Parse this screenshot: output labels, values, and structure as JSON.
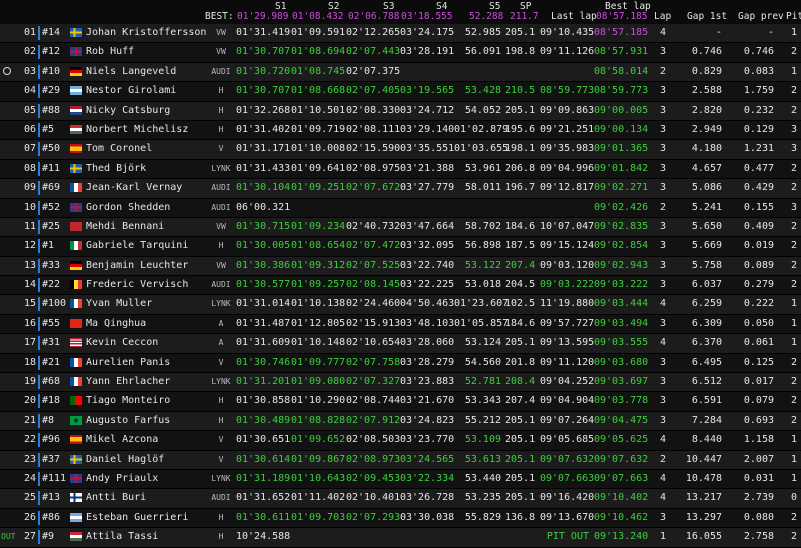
{
  "header": {
    "best_label": "BEST:",
    "cols": {
      "s1": "S1",
      "s2": "S2",
      "s3": "S3",
      "s4": "S4",
      "s5": "S5",
      "sp": "SP",
      "last": "Last lap",
      "best_top": "Best lap",
      "lap": "Lap",
      "gap1": "Gap 1st",
      "gapp": "Gap prev",
      "pit": "Pit"
    },
    "best": {
      "s1": "01'29.989",
      "s2": "01'08.432",
      "s3": "02'06.788",
      "s4": "03'18.555",
      "s5": "52.288",
      "sp": "211.7",
      "best": "08'57.185"
    }
  },
  "rows": [
    {
      "pos": "01",
      "num": "#14",
      "flag": "se",
      "name": "Johan Kristoffersson",
      "logo": "VW",
      "s1": [
        "01'31.419",
        "w"
      ],
      "s2": [
        "01'09.591",
        "w"
      ],
      "s3": [
        "02'12.265",
        "w"
      ],
      "s4": [
        "03'24.175",
        "w"
      ],
      "s5": [
        "52.985",
        "w"
      ],
      "sp": [
        "205.1",
        "w"
      ],
      "last": [
        "09'10.435",
        "w"
      ],
      "best": [
        "08'57.185",
        "p"
      ],
      "lap": "4",
      "gap1": "-",
      "gapp": "-",
      "pit": "1"
    },
    {
      "pos": "02",
      "num": "#12",
      "flag": "gb",
      "name": "Rob Huff",
      "logo": "VW",
      "s1": [
        "01'30.707",
        "g"
      ],
      "s2": [
        "01'08.694",
        "g"
      ],
      "s3": [
        "02'07.443",
        "g"
      ],
      "s4": [
        "03'28.191",
        "w"
      ],
      "s5": [
        "56.091",
        "w"
      ],
      "sp": [
        "198.8",
        "w"
      ],
      "last": [
        "09'11.126",
        "w"
      ],
      "best": [
        "08'57.931",
        "g"
      ],
      "lap": "3",
      "gap1": "0.746",
      "gapp": "0.746",
      "pit": "2"
    },
    {
      "pos": "03",
      "num": "#10",
      "flag": "de",
      "name": "Niels Langeveld",
      "logo": "AUDI",
      "s1": [
        "01'30.720",
        "g"
      ],
      "s2": [
        "01'08.745",
        "g"
      ],
      "s3": [
        "02'07.375",
        "w"
      ],
      "s4": [
        "",
        "w"
      ],
      "s5": [
        "",
        "w"
      ],
      "sp": [
        "",
        "w"
      ],
      "last": [
        "",
        "w"
      ],
      "best": [
        "08'58.014",
        "g"
      ],
      "lap": "2",
      "gap1": "0.829",
      "gapp": "0.083",
      "pit": "1"
    },
    {
      "pos": "04",
      "num": "#29",
      "flag": "ar",
      "name": "Nestor Girolami",
      "logo": "H",
      "s1": [
        "01'30.707",
        "g"
      ],
      "s2": [
        "01'08.668",
        "g"
      ],
      "s3": [
        "02'07.405",
        "g"
      ],
      "s4": [
        "03'19.565",
        "g"
      ],
      "s5": [
        "53.428",
        "g"
      ],
      "sp": [
        "210.5",
        "g"
      ],
      "last": [
        "08'59.773",
        "g"
      ],
      "best": [
        "08'59.773",
        "g"
      ],
      "lap": "3",
      "gap1": "2.588",
      "gapp": "1.759",
      "pit": "2"
    },
    {
      "pos": "05",
      "num": "#88",
      "flag": "nl",
      "name": "Nicky Catsburg",
      "logo": "H",
      "s1": [
        "01'32.268",
        "w"
      ],
      "s2": [
        "01'10.501",
        "w"
      ],
      "s3": [
        "02'08.330",
        "w"
      ],
      "s4": [
        "03'24.712",
        "w"
      ],
      "s5": [
        "54.052",
        "w"
      ],
      "sp": [
        "205.1",
        "w"
      ],
      "last": [
        "09'09.863",
        "w"
      ],
      "best": [
        "09'00.005",
        "g"
      ],
      "lap": "3",
      "gap1": "2.820",
      "gapp": "0.232",
      "pit": "2"
    },
    {
      "pos": "06",
      "num": "#5",
      "flag": "hu",
      "name": "Norbert Michelisz",
      "logo": "H",
      "s1": [
        "01'31.402",
        "w"
      ],
      "s2": [
        "01'09.719",
        "w"
      ],
      "s3": [
        "02'08.111",
        "w"
      ],
      "s4": [
        "03'29.140",
        "w"
      ],
      "s5": [
        "01'02.879",
        "w"
      ],
      "sp": [
        "195.6",
        "w"
      ],
      "last": [
        "09'21.251",
        "w"
      ],
      "best": [
        "09'00.134",
        "g"
      ],
      "lap": "3",
      "gap1": "2.949",
      "gapp": "0.129",
      "pit": "3"
    },
    {
      "pos": "07",
      "num": "#50",
      "flag": "es",
      "name": "Tom Coronel",
      "logo": "V",
      "s1": [
        "01'31.171",
        "w"
      ],
      "s2": [
        "01'10.008",
        "w"
      ],
      "s3": [
        "02'15.590",
        "w"
      ],
      "s4": [
        "03'35.551",
        "w"
      ],
      "s5": [
        "01'03.655",
        "w"
      ],
      "sp": [
        "198.1",
        "w"
      ],
      "last": [
        "09'35.983",
        "w"
      ],
      "best": [
        "09'01.365",
        "g"
      ],
      "lap": "3",
      "gap1": "4.180",
      "gapp": "1.231",
      "pit": "3"
    },
    {
      "pos": "08",
      "num": "#11",
      "flag": "se",
      "name": "Thed Björk",
      "logo": "LYNK",
      "s1": [
        "01'31.433",
        "w"
      ],
      "s2": [
        "01'09.641",
        "w"
      ],
      "s3": [
        "02'08.975",
        "w"
      ],
      "s4": [
        "03'21.388",
        "w"
      ],
      "s5": [
        "53.961",
        "w"
      ],
      "sp": [
        "206.8",
        "w"
      ],
      "last": [
        "09'04.996",
        "w"
      ],
      "best": [
        "09'01.842",
        "g"
      ],
      "lap": "3",
      "gap1": "4.657",
      "gapp": "0.477",
      "pit": "2"
    },
    {
      "pos": "09",
      "num": "#69",
      "flag": "fr",
      "name": "Jean-Karl Vernay",
      "logo": "AUDI",
      "s1": [
        "01'30.104",
        "g"
      ],
      "s2": [
        "01'09.251",
        "g"
      ],
      "s3": [
        "02'07.672",
        "g"
      ],
      "s4": [
        "03'27.779",
        "w"
      ],
      "s5": [
        "58.011",
        "w"
      ],
      "sp": [
        "196.7",
        "w"
      ],
      "last": [
        "09'12.817",
        "w"
      ],
      "best": [
        "09'02.271",
        "g"
      ],
      "lap": "3",
      "gap1": "5.086",
      "gapp": "0.429",
      "pit": "2"
    },
    {
      "pos": "10",
      "num": "#52",
      "flag": "gb",
      "name": "Gordon Shedden",
      "logo": "AUDI",
      "s1": [
        "06'00.321",
        "w"
      ],
      "s2": [
        "",
        "w"
      ],
      "s3": [
        "",
        "w"
      ],
      "s4": [
        "",
        "w"
      ],
      "s5": [
        "",
        "w"
      ],
      "sp": [
        "",
        "w"
      ],
      "last": [
        "",
        "w"
      ],
      "best": [
        "09'02.426",
        "g"
      ],
      "lap": "2",
      "gap1": "5.241",
      "gapp": "0.155",
      "pit": "3"
    },
    {
      "pos": "11",
      "num": "#25",
      "flag": "ma",
      "name": "Mehdi Bennani",
      "logo": "VW",
      "s1": [
        "01'30.715",
        "g"
      ],
      "s2": [
        "01'09.234",
        "g"
      ],
      "s3": [
        "02'40.732",
        "w"
      ],
      "s4": [
        "03'47.664",
        "w"
      ],
      "s5": [
        "58.702",
        "w"
      ],
      "sp": [
        "184.6",
        "w"
      ],
      "last": [
        "10'07.047",
        "w"
      ],
      "best": [
        "09'02.835",
        "g"
      ],
      "lap": "3",
      "gap1": "5.650",
      "gapp": "0.409",
      "pit": "2"
    },
    {
      "pos": "12",
      "num": "#1",
      "flag": "it",
      "name": "Gabriele Tarquini",
      "logo": "H",
      "s1": [
        "01'30.005",
        "g"
      ],
      "s2": [
        "01'08.654",
        "g"
      ],
      "s3": [
        "02'07.472",
        "g"
      ],
      "s4": [
        "03'32.095",
        "w"
      ],
      "s5": [
        "56.898",
        "w"
      ],
      "sp": [
        "187.5",
        "w"
      ],
      "last": [
        "09'15.124",
        "w"
      ],
      "best": [
        "09'02.854",
        "g"
      ],
      "lap": "3",
      "gap1": "5.669",
      "gapp": "0.019",
      "pit": "2"
    },
    {
      "pos": "13",
      "num": "#33",
      "flag": "de",
      "name": "Benjamin Leuchter",
      "logo": "VW",
      "s1": [
        "01'30.386",
        "g"
      ],
      "s2": [
        "01'09.312",
        "g"
      ],
      "s3": [
        "02'07.525",
        "g"
      ],
      "s4": [
        "03'22.740",
        "w"
      ],
      "s5": [
        "53.122",
        "g"
      ],
      "sp": [
        "207.4",
        "g"
      ],
      "last": [
        "09'03.120",
        "w"
      ],
      "best": [
        "09'02.943",
        "g"
      ],
      "lap": "3",
      "gap1": "5.758",
      "gapp": "0.089",
      "pit": "2"
    },
    {
      "pos": "14",
      "num": "#22",
      "flag": "be",
      "name": "Frederic Vervisch",
      "logo": "AUDI",
      "s1": [
        "01'30.577",
        "g"
      ],
      "s2": [
        "01'09.257",
        "g"
      ],
      "s3": [
        "02'08.145",
        "g"
      ],
      "s4": [
        "03'22.225",
        "w"
      ],
      "s5": [
        "53.018",
        "w"
      ],
      "sp": [
        "204.5",
        "w"
      ],
      "last": [
        "09'03.222",
        "g"
      ],
      "best": [
        "09'03.222",
        "g"
      ],
      "lap": "3",
      "gap1": "6.037",
      "gapp": "0.279",
      "pit": "2"
    },
    {
      "pos": "15",
      "num": "#100",
      "flag": "fr",
      "name": "Yvan Muller",
      "logo": "LYNK",
      "s1": [
        "01'31.014",
        "w"
      ],
      "s2": [
        "01'10.138",
        "w"
      ],
      "s3": [
        "02'24.460",
        "w"
      ],
      "s4": [
        "04'50.463",
        "w"
      ],
      "s5": [
        "01'23.607",
        "w"
      ],
      "sp": [
        "102.5",
        "w"
      ],
      "last": [
        "11'19.880",
        "w"
      ],
      "best": [
        "09'03.444",
        "g"
      ],
      "lap": "4",
      "gap1": "6.259",
      "gapp": "0.222",
      "pit": "1"
    },
    {
      "pos": "16",
      "num": "#55",
      "flag": "cn",
      "name": "Ma Qinghua",
      "logo": "A",
      "s1": [
        "01'31.487",
        "w"
      ],
      "s2": [
        "01'12.805",
        "w"
      ],
      "s3": [
        "02'15.913",
        "w"
      ],
      "s4": [
        "03'48.103",
        "w"
      ],
      "s5": [
        "01'05.857",
        "w"
      ],
      "sp": [
        "184.6",
        "w"
      ],
      "last": [
        "09'57.727",
        "w"
      ],
      "best": [
        "09'03.494",
        "g"
      ],
      "lap": "3",
      "gap1": "6.309",
      "gapp": "0.050",
      "pit": "1"
    },
    {
      "pos": "17",
      "num": "#31",
      "flag": "us",
      "name": "Kevin Ceccon",
      "logo": "A",
      "s1": [
        "01'31.609",
        "w"
      ],
      "s2": [
        "01'10.148",
        "w"
      ],
      "s3": [
        "02'10.654",
        "w"
      ],
      "s4": [
        "03'28.060",
        "w"
      ],
      "s5": [
        "53.124",
        "w"
      ],
      "sp": [
        "205.1",
        "w"
      ],
      "last": [
        "09'13.595",
        "w"
      ],
      "best": [
        "09'03.555",
        "g"
      ],
      "lap": "4",
      "gap1": "6.370",
      "gapp": "0.061",
      "pit": "1"
    },
    {
      "pos": "18",
      "num": "#21",
      "flag": "fr",
      "name": "Aurelien Panis",
      "logo": "V",
      "s1": [
        "01'30.746",
        "g"
      ],
      "s2": [
        "01'09.777",
        "g"
      ],
      "s3": [
        "02'07.758",
        "g"
      ],
      "s4": [
        "03'28.279",
        "w"
      ],
      "s5": [
        "54.560",
        "w"
      ],
      "sp": [
        "201.8",
        "w"
      ],
      "last": [
        "09'11.120",
        "w"
      ],
      "best": [
        "09'03.680",
        "g"
      ],
      "lap": "3",
      "gap1": "6.495",
      "gapp": "0.125",
      "pit": "2"
    },
    {
      "pos": "19",
      "num": "#68",
      "flag": "fr",
      "name": "Yann Ehrlacher",
      "logo": "LYNK",
      "s1": [
        "01'31.201",
        "g"
      ],
      "s2": [
        "01'09.080",
        "g"
      ],
      "s3": [
        "02'07.327",
        "g"
      ],
      "s4": [
        "03'23.883",
        "w"
      ],
      "s5": [
        "52.781",
        "g"
      ],
      "sp": [
        "208.4",
        "g"
      ],
      "last": [
        "09'04.252",
        "w"
      ],
      "best": [
        "09'03.697",
        "g"
      ],
      "lap": "3",
      "gap1": "6.512",
      "gapp": "0.017",
      "pit": "2"
    },
    {
      "pos": "20",
      "num": "#18",
      "flag": "pt",
      "name": "Tiago Monteiro",
      "logo": "H",
      "s1": [
        "01'30.858",
        "w"
      ],
      "s2": [
        "01'10.290",
        "w"
      ],
      "s3": [
        "02'08.744",
        "w"
      ],
      "s4": [
        "03'21.670",
        "w"
      ],
      "s5": [
        "53.343",
        "w"
      ],
      "sp": [
        "207.4",
        "w"
      ],
      "last": [
        "09'04.904",
        "w"
      ],
      "best": [
        "09'03.778",
        "g"
      ],
      "lap": "3",
      "gap1": "6.591",
      "gapp": "0.079",
      "pit": "2"
    },
    {
      "pos": "21",
      "num": "#8",
      "flag": "br",
      "name": "Augusto Farfus",
      "logo": "H",
      "s1": [
        "01'30.489",
        "g"
      ],
      "s2": [
        "01'08.828",
        "g"
      ],
      "s3": [
        "02'07.912",
        "g"
      ],
      "s4": [
        "03'24.823",
        "w"
      ],
      "s5": [
        "55.212",
        "w"
      ],
      "sp": [
        "205.1",
        "w"
      ],
      "last": [
        "09'07.264",
        "w"
      ],
      "best": [
        "09'04.475",
        "g"
      ],
      "lap": "3",
      "gap1": "7.284",
      "gapp": "0.693",
      "pit": "2"
    },
    {
      "pos": "22",
      "num": "#96",
      "flag": "es",
      "name": "Mikel Azcona",
      "logo": "V",
      "s1": [
        "01'30.651",
        "w"
      ],
      "s2": [
        "01'09.652",
        "g"
      ],
      "s3": [
        "02'08.503",
        "w"
      ],
      "s4": [
        "03'23.770",
        "w"
      ],
      "s5": [
        "53.109",
        "g"
      ],
      "sp": [
        "205.1",
        "w"
      ],
      "last": [
        "09'05.685",
        "w"
      ],
      "best": [
        "09'05.625",
        "g"
      ],
      "lap": "4",
      "gap1": "8.440",
      "gapp": "1.158",
      "pit": "1"
    },
    {
      "pos": "23",
      "num": "#37",
      "flag": "se",
      "name": "Daniel Haglöf",
      "logo": "V",
      "s1": [
        "01'30.614",
        "g"
      ],
      "s2": [
        "01'09.867",
        "g"
      ],
      "s3": [
        "02'08.973",
        "g"
      ],
      "s4": [
        "03'24.565",
        "g"
      ],
      "s5": [
        "53.613",
        "g"
      ],
      "sp": [
        "205.1",
        "g"
      ],
      "last": [
        "09'07.632",
        "g"
      ],
      "best": [
        "09'07.632",
        "g"
      ],
      "lap": "2",
      "gap1": "10.447",
      "gapp": "2.007",
      "pit": "1"
    },
    {
      "pos": "24",
      "num": "#111",
      "flag": "gb",
      "name": "Andy Priaulx",
      "logo": "LYNK",
      "s1": [
        "01'31.189",
        "g"
      ],
      "s2": [
        "01'10.643",
        "g"
      ],
      "s3": [
        "02'09.453",
        "g"
      ],
      "s4": [
        "03'22.334",
        "g"
      ],
      "s5": [
        "53.440",
        "w"
      ],
      "sp": [
        "205.1",
        "w"
      ],
      "last": [
        "09'07.663",
        "g"
      ],
      "best": [
        "09'07.663",
        "g"
      ],
      "lap": "4",
      "gap1": "10.478",
      "gapp": "0.031",
      "pit": "1"
    },
    {
      "pos": "25",
      "num": "#13",
      "flag": "fi",
      "name": "Antti Buri",
      "logo": "AUDI",
      "s1": [
        "01'31.652",
        "w"
      ],
      "s2": [
        "01'11.402",
        "w"
      ],
      "s3": [
        "02'10.401",
        "w"
      ],
      "s4": [
        "03'26.728",
        "w"
      ],
      "s5": [
        "53.235",
        "w"
      ],
      "sp": [
        "205.1",
        "w"
      ],
      "last": [
        "09'16.420",
        "w"
      ],
      "best": [
        "09'10.402",
        "g"
      ],
      "lap": "4",
      "gap1": "13.217",
      "gapp": "2.739",
      "pit": "0"
    },
    {
      "pos": "26",
      "num": "#86",
      "flag": "ar",
      "name": "Esteban Guerrieri",
      "logo": "H",
      "s1": [
        "01'30.611",
        "g"
      ],
      "s2": [
        "01'09.703",
        "g"
      ],
      "s3": [
        "02'07.293",
        "g"
      ],
      "s4": [
        "03'30.038",
        "w"
      ],
      "s5": [
        "55.829",
        "w"
      ],
      "sp": [
        "136.8",
        "w"
      ],
      "last": [
        "09'13.670",
        "w"
      ],
      "best": [
        "09'10.462",
        "g"
      ],
      "lap": "3",
      "gap1": "13.297",
      "gapp": "0.080",
      "pit": "2"
    },
    {
      "pos": "27",
      "num": "#9",
      "flag": "hu",
      "name": "Attila Tassi",
      "logo": "H",
      "s1": [
        "10'24.588",
        "w"
      ],
      "s2": [
        "",
        "w"
      ],
      "s3": [
        "",
        "w"
      ],
      "s4": [
        "",
        "w"
      ],
      "s5": [
        "",
        "w"
      ],
      "sp": [
        "",
        "w"
      ],
      "last": [
        "PIT OUT",
        "g"
      ],
      "best": [
        "09'13.240",
        "g"
      ],
      "lap": "1",
      "gap1": "16.055",
      "gapp": "2.758",
      "pit": "2"
    }
  ],
  "side": {
    "out_label": "OUT"
  },
  "colors": {
    "purple": "#c84fd8",
    "green": "#3ad13a",
    "bar": "#2a7fd4"
  }
}
